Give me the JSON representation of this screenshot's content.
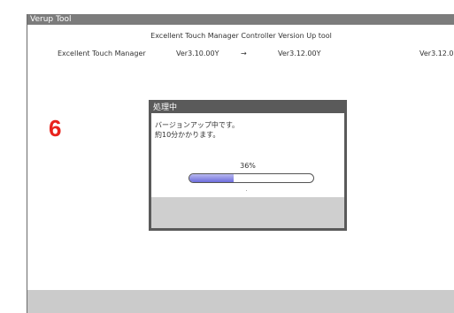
{
  "window": {
    "title": "Verup Tool"
  },
  "header": {
    "heading": "Excellent Touch Manager Controller Version Up tool"
  },
  "versions": {
    "product": "Excellent Touch Manager",
    "from": "Ver3.10.00Y",
    "arrow": "→",
    "to": "Ver3.12.00Y",
    "right": "Ver3.12.0"
  },
  "annotation": {
    "step": "6"
  },
  "dialog": {
    "title": "処理中",
    "line1": "バージョンアップ中です。",
    "line2": "約10分かかります。",
    "progress_text": "36%",
    "progress_value": 36
  },
  "colors": {
    "step_number": "#e8231d",
    "progress_fill": "#6d6ddc",
    "titlebar": "#7c7c7c"
  }
}
